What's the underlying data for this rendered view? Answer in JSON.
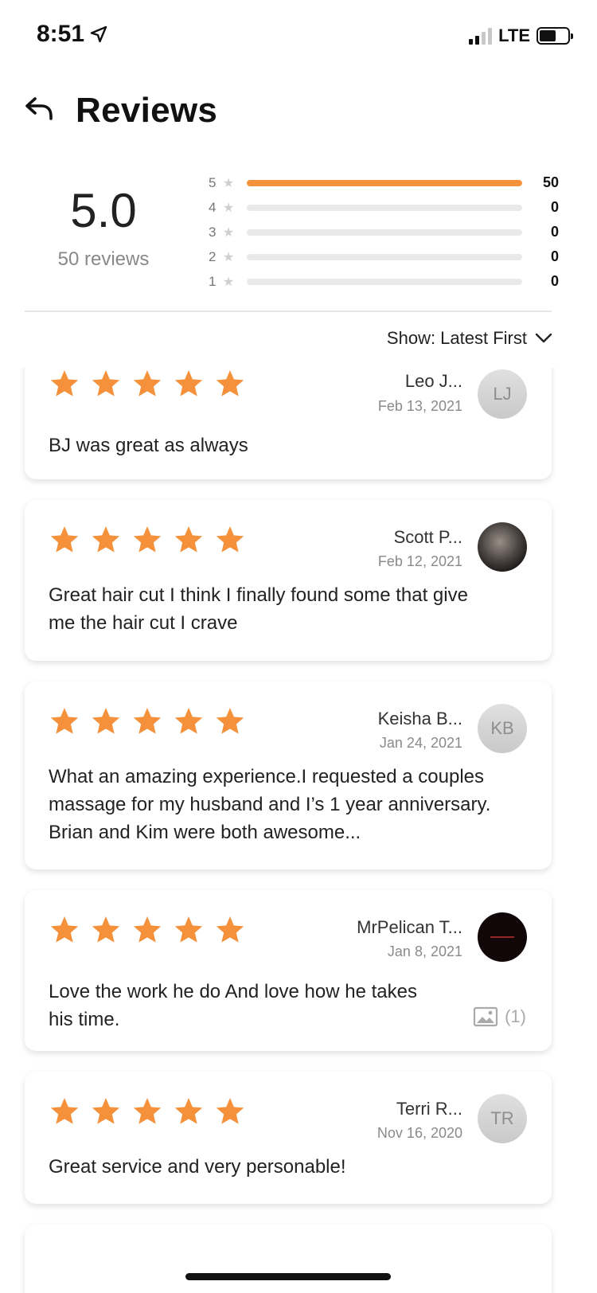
{
  "status": {
    "time": "8:51",
    "network": "LTE"
  },
  "header": {
    "title": "Reviews"
  },
  "summary": {
    "average": "5.0",
    "total_label": "50 reviews",
    "distribution": [
      {
        "stars": "5",
        "count": "50",
        "fraction": 1.0
      },
      {
        "stars": "4",
        "count": "0",
        "fraction": 0
      },
      {
        "stars": "3",
        "count": "0",
        "fraction": 0
      },
      {
        "stars": "2",
        "count": "0",
        "fraction": 0
      },
      {
        "stars": "1",
        "count": "0",
        "fraction": 0
      }
    ]
  },
  "sort": {
    "label": "Show: Latest First"
  },
  "reviews": [
    {
      "rating": 5,
      "name": "Leo J...",
      "date": "Feb 13, 2021",
      "initials": "LJ",
      "avatar_type": "initials",
      "text": "BJ was great as always"
    },
    {
      "rating": 5,
      "name": "Scott P...",
      "date": "Feb 12, 2021",
      "initials": "",
      "avatar_type": "photo",
      "text": "Great hair cut I think I finally found some that give me the hair cut I crave"
    },
    {
      "rating": 5,
      "name": "Keisha B...",
      "date": "Jan 24, 2021",
      "initials": "KB",
      "avatar_type": "initials",
      "text": "What an amazing experience.I requested a couples massage for my husband and I’s 1 year anniversary. Brian and Kim were both awesome..."
    },
    {
      "rating": 5,
      "name": "MrPelican T...",
      "date": "Jan 8, 2021",
      "initials": "",
      "avatar_type": "logo",
      "text": "Love the work he do And love how he takes his time.",
      "photo_count": "(1)"
    },
    {
      "rating": 5,
      "name": "Terri R...",
      "date": "Nov 16, 2020",
      "initials": "TR",
      "avatar_type": "initials",
      "text": "Great service and very personable!"
    }
  ],
  "colors": {
    "accent": "#f4913a",
    "track": "#e9e9e9"
  }
}
